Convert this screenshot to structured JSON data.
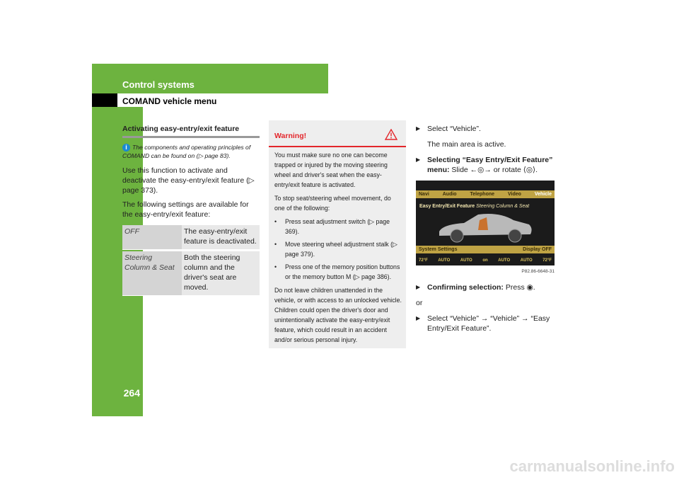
{
  "header": {
    "section": "Control systems",
    "subsection": "COMAND vehicle menu",
    "page_number": "264",
    "accent_color": "#6db33f"
  },
  "left": {
    "heading": "Activating easy-entry/exit feature",
    "note": "The components and operating principles of COMAND can be found on (▷ page 83).",
    "para1": "Use this function to activate and deactivate the easy-entry/exit feature (▷ page 373).",
    "para2": "The following settings are available for the easy-entry/exit feature:",
    "table": [
      {
        "setting": "OFF",
        "description": "The easy-entry/exit feature is deactivated."
      },
      {
        "setting": "Steering Column & Seat",
        "description": "Both the steering column and the driver's seat are moved."
      }
    ]
  },
  "warning": {
    "title": "Warning!",
    "p1": "You must make sure no one can become trapped or injured by the moving steering wheel and driver's seat when the easy-entry/exit feature is activated.",
    "p2": "To stop seat/steering wheel movement, do one of the following:",
    "bullets": [
      "Press seat adjustment switch (▷ page 369).",
      "Move steering wheel adjustment stalk (▷ page 379).",
      "Press one of the memory position buttons or the memory button M (▷ page 386)."
    ],
    "p3": "Do not leave children unattended in the vehicle, or with access to an unlocked vehicle. Children could open the driver's door and unintentionally activate the easy-entry/exit feature, which could result in an accident and/or serious personal injury."
  },
  "right": {
    "step1": "Select “Vehicle”.",
    "step1_result": "The main area is active.",
    "step2_bold": "Selecting “Easy Entry/Exit Feature” menu:",
    "step2_rest": "Slide ←◎→ or rotate ⟨◎⟩.",
    "screen": {
      "menu": [
        "Navi",
        "Audio",
        "Telephone",
        "Video",
        "Vehicle"
      ],
      "title": "Easy Entry/Exit Feature",
      "title_value": "Steering Column & Seat",
      "bottom_left": "System Settings",
      "bottom_right": "Display OFF",
      "climate": [
        "72°F",
        "AUTO",
        "AUTO",
        "on",
        "AUTO",
        "AUTO",
        "72°F"
      ]
    },
    "caption": "P82.86-6648-31",
    "step3_bold": "Confirming selection:",
    "step3_rest": "Press ◉.",
    "or": "or",
    "step4": "Select “Vehicle” → “Vehicle” → “Easy Entry/Exit Feature”."
  },
  "watermark": "carmanualsonline.info"
}
